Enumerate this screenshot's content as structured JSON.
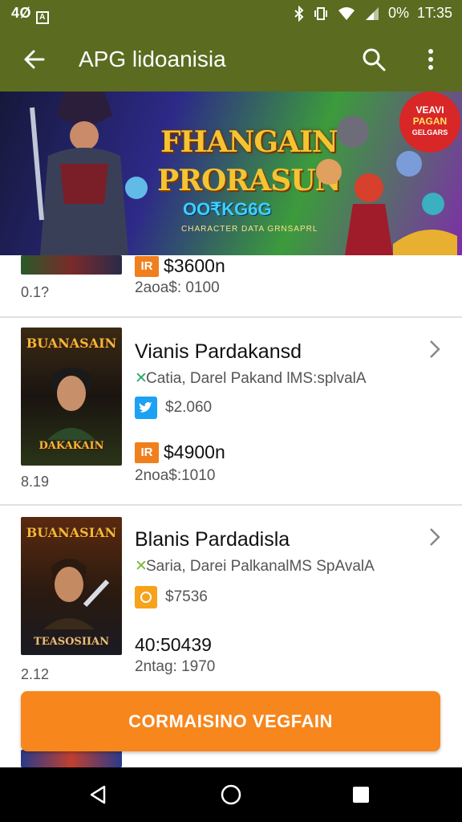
{
  "status_bar": {
    "left_text": "4Ø",
    "battery": "0%",
    "time": "1T:35",
    "icons": [
      "bluetooth-icon",
      "vibrate-icon",
      "wifi-icon",
      "signal-icon"
    ]
  },
  "app_bar": {
    "title": "APG lidoanisia",
    "icons": [
      "back-arrow-icon",
      "search-icon",
      "more-vert-icon"
    ]
  },
  "banner": {
    "title_line1": "FHANGAIN",
    "title_line2": "PRORASUN",
    "subtitle": "OO₹KG6G",
    "tagline": "CHARACTER DATA GRNSAPRL",
    "badge_line1": "VEAVI",
    "badge_line2": "PAGAN",
    "badge_line3": "GELGARS"
  },
  "list": {
    "items": [
      {
        "rank": "0.1?",
        "price_tag": "IR",
        "price": "$3600n",
        "meta": "2aoa$: 0100"
      },
      {
        "rank": "8.19",
        "thumb_title_top": "BUANASAIN",
        "thumb_title_bottom": "DAKAKAIN",
        "name": "Vianis Pardakansd",
        "subtitle": "Catia, Darel Pakand lMS:splvalA",
        "chip_icon": "twitter-icon",
        "chip_value": "$2.060",
        "price_tag": "IR",
        "price": "$4900n",
        "meta": "2noa$:1010"
      },
      {
        "rank": "2.12",
        "thumb_title_top": "BUANASIAN",
        "thumb_title_bottom": "TEASOSIIAN",
        "name": "Blanis Pardadisla",
        "subtitle": "Saria, Darei PalkanalMS SpAvalA",
        "chip_icon": "coin-icon",
        "chip_value": "$7536",
        "price": "40:50439",
        "meta": "2ntag: 1970"
      }
    ]
  },
  "cta": {
    "label": "CORMAISINO VEGFAIN"
  },
  "nav_bar": {
    "icons": [
      "back-triangle-icon",
      "home-circle-icon",
      "recents-square-icon"
    ]
  },
  "colors": {
    "app_bar": "#5b6b20",
    "accent": "#f7861c",
    "twitter": "#1da1f2",
    "coin": "#f6a21a"
  }
}
